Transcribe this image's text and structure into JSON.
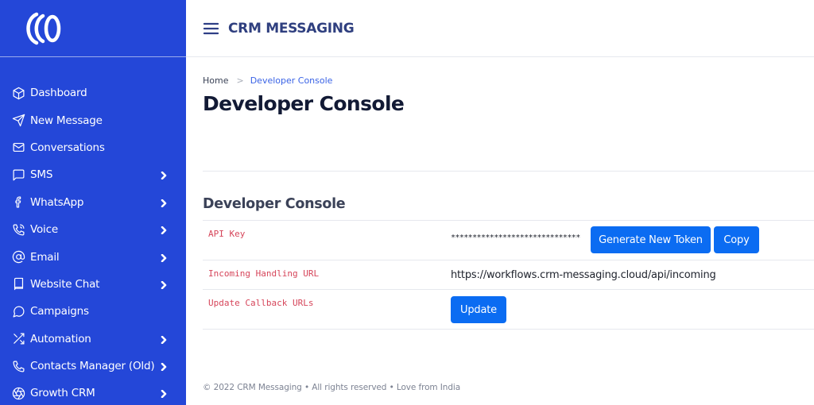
{
  "sidebar": {
    "logo_icon": "brand-logo-icon",
    "items": [
      {
        "label": "Dashboard",
        "icon": "cube-icon",
        "has_submenu": false
      },
      {
        "label": "New Message",
        "icon": "send-icon",
        "has_submenu": false
      },
      {
        "label": "Conversations",
        "icon": "mail-icon",
        "has_submenu": false
      },
      {
        "label": "SMS",
        "icon": "chat-square-icon",
        "has_submenu": true
      },
      {
        "label": "WhatsApp",
        "icon": "facebook-icon",
        "has_submenu": true
      },
      {
        "label": "Voice",
        "icon": "phone-call-icon",
        "has_submenu": true
      },
      {
        "label": "Email",
        "icon": "at-sign-icon",
        "has_submenu": true
      },
      {
        "label": "Website Chat",
        "icon": "book-icon",
        "has_submenu": true
      },
      {
        "label": "Campaigns",
        "icon": "chat-bubble-icon",
        "has_submenu": false
      },
      {
        "label": "Automation",
        "icon": "shuffle-icon",
        "has_submenu": true
      },
      {
        "label": "Contacts Manager (Old)",
        "icon": "phone-icon",
        "has_submenu": true
      },
      {
        "label": "Growth CRM",
        "icon": "aperture-icon",
        "has_submenu": true
      }
    ]
  },
  "header": {
    "menu_icon": "hamburger-icon",
    "title": "CRM MESSAGING"
  },
  "breadcrumb": {
    "home": "Home",
    "current": "Developer Console"
  },
  "page": {
    "title": "Developer Console",
    "section_title": "Developer Console"
  },
  "settings": {
    "api_key": {
      "label": "API Key",
      "value": "******************************",
      "generate_label": "Generate New Token",
      "copy_label": "Copy"
    },
    "incoming_url": {
      "label": "Incoming Handling URL",
      "value": "https://workflows.crm-messaging.cloud/api/incoming"
    },
    "callback": {
      "label": "Update Callback URLs",
      "update_label": "Update"
    }
  },
  "footer": {
    "text": "© 2022 CRM Messaging • All rights reserved • Love from India"
  },
  "colors": {
    "sidebar_bg": "#2447d8",
    "accent": "#0b6cf2",
    "key_text": "#d6455a",
    "title_text": "#2f3f7f"
  }
}
